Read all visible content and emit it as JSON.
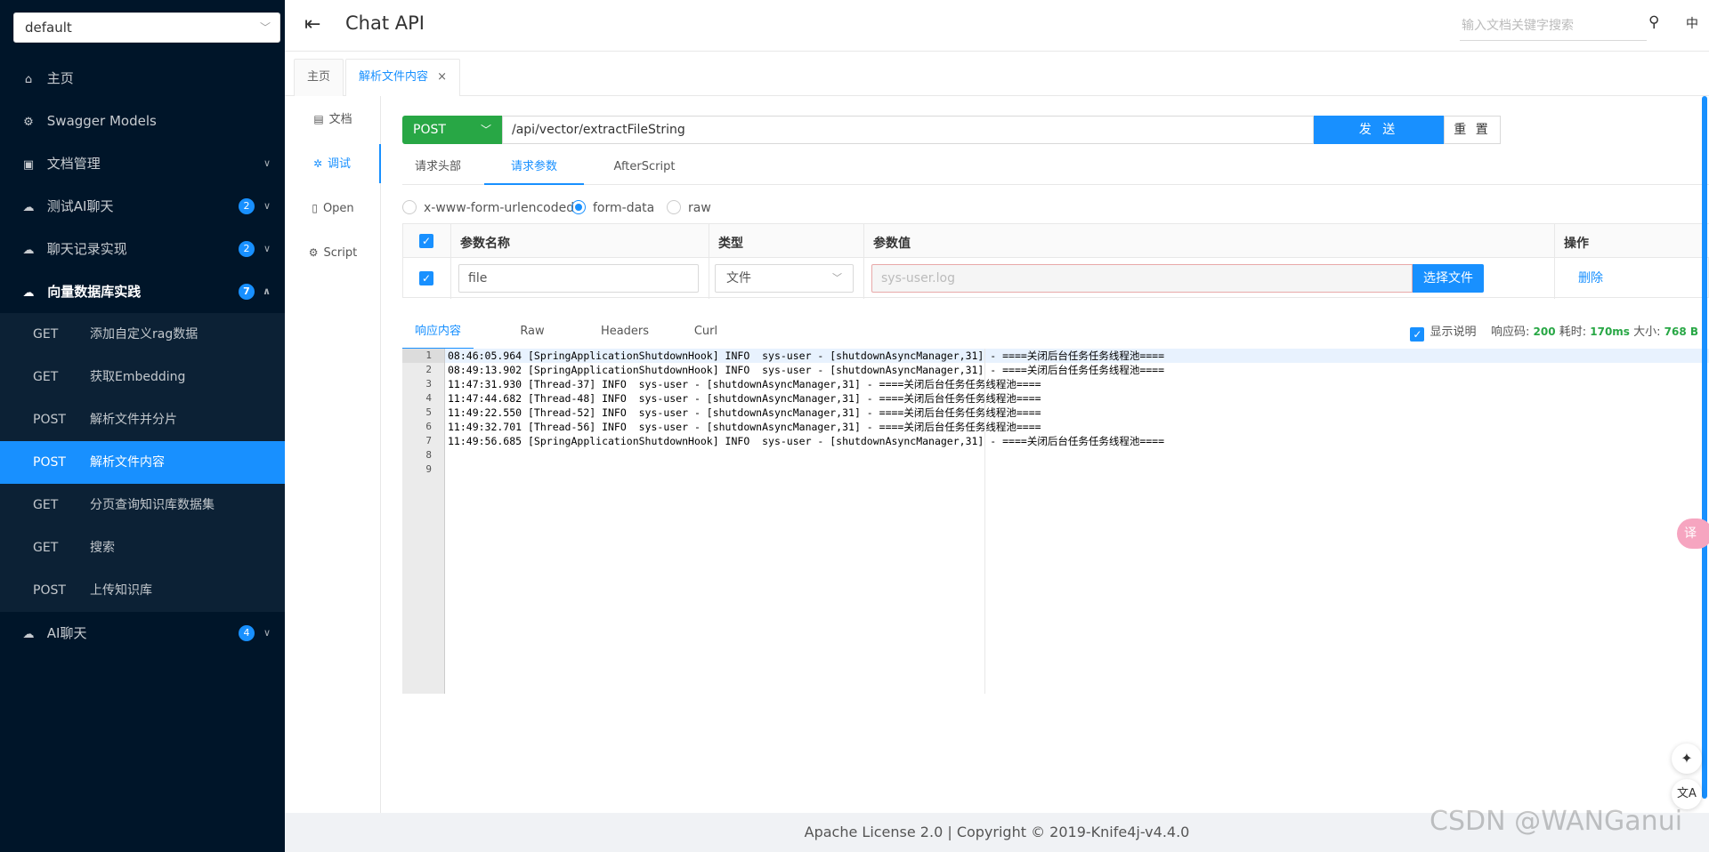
{
  "sidebar": {
    "group_select": "default",
    "menu": [
      {
        "label": "主页",
        "icon": "home-icon",
        "glyph": "⌂"
      },
      {
        "label": "Swagger Models",
        "icon": "gear-icon",
        "glyph": "⚙"
      },
      {
        "label": "文档管理",
        "icon": "document-icon",
        "glyph": "▣"
      },
      {
        "label": "测试AI聊天",
        "icon": "cloud-icon",
        "glyph": "☁",
        "badge": "2"
      },
      {
        "label": "聊天记录实现",
        "icon": "cloud-icon",
        "glyph": "☁",
        "badge": "2"
      },
      {
        "label": "向量数据库实践",
        "icon": "cloud-icon",
        "glyph": "☁",
        "badge": "7"
      },
      {
        "label": "AI聊天",
        "icon": "cloud-icon",
        "glyph": "☁",
        "badge": "4"
      }
    ],
    "sub_items": [
      {
        "method": "GET",
        "label": "添加自定义rag数据"
      },
      {
        "method": "GET",
        "label": "获取Embedding"
      },
      {
        "method": "POST",
        "label": "解析文件并分片"
      },
      {
        "method": "POST",
        "label": "解析文件内容"
      },
      {
        "method": "GET",
        "label": "分页查询知识库数据集"
      },
      {
        "method": "GET",
        "label": "搜索"
      },
      {
        "method": "POST",
        "label": "上传知识库"
      }
    ]
  },
  "header": {
    "title": "Chat API",
    "search_placeholder": "输入文档关键字搜索",
    "lang": "中"
  },
  "tabs": [
    {
      "label": "主页"
    },
    {
      "label": "解析文件内容",
      "close": "×"
    }
  ],
  "left_nav": [
    {
      "label": "文档",
      "glyph": "▤"
    },
    {
      "label": "调试",
      "glyph": "✲"
    },
    {
      "label": "Open",
      "glyph": "▯"
    },
    {
      "label": "Script",
      "glyph": "⚙"
    }
  ],
  "request": {
    "method": "POST",
    "url": "/api/vector/extractFileString",
    "send_label": "发 送",
    "reset_label": "重 置",
    "tabs": [
      "请求头部",
      "请求参数",
      "AfterScript"
    ],
    "body_types": [
      "x-www-form-urlencoded",
      "form-data",
      "raw"
    ],
    "selected_body_type": "form-data"
  },
  "param_table": {
    "headers": {
      "name": "参数名称",
      "type": "类型",
      "value": "参数值",
      "action": "操作"
    },
    "row": {
      "name": "file",
      "type": "文件",
      "value_placeholder": "sys-user.log",
      "choose_label": "选择文件",
      "delete_label": "删除"
    }
  },
  "response": {
    "tabs": [
      "响应内容",
      "Raw",
      "Headers",
      "Curl"
    ],
    "show_desc": "显示说明",
    "code_label": "响应码:",
    "code": "200",
    "time_label": "耗时:",
    "time": "170ms",
    "size_label": "大小:",
    "size": "768 B",
    "line_numbers": [
      "1",
      "2",
      "3",
      "4",
      "5",
      "6",
      "7",
      "8",
      "9"
    ],
    "lines": [
      "08:46:05.964 [SpringApplicationShutdownHook] INFO  sys-user - [shutdownAsyncManager,31] - ====关闭后台任务任务线程池====",
      "08:49:13.902 [SpringApplicationShutdownHook] INFO  sys-user - [shutdownAsyncManager,31] - ====关闭后台任务任务线程池====",
      "11:47:31.930 [Thread-37] INFO  sys-user - [shutdownAsyncManager,31] - ====关闭后台任务任务线程池====",
      "11:47:44.682 [Thread-48] INFO  sys-user - [shutdownAsyncManager,31] - ====关闭后台任务任务线程池====",
      "11:49:22.550 [Thread-52] INFO  sys-user - [shutdownAsyncManager,31] - ====关闭后台任务任务线程池====",
      "11:49:32.701 [Thread-56] INFO  sys-user - [shutdownAsyncManager,31] - ====关闭后台任务任务线程池====",
      "11:49:56.685 [SpringApplicationShutdownHook] INFO  sys-user - [shutdownAsyncManager,31] - ====关闭后台任务任务线程池====",
      "",
      ""
    ]
  },
  "footer": "Apache License 2.0 | Copyright © 2019-Knife4j-v4.4.0",
  "watermark": "CSDN @WANGanui",
  "floating": {
    "sparkle": "✦",
    "translate": "文A",
    "bubble": "译"
  },
  "colors": {
    "sidebar_bg": "#001529",
    "accent": "#1890ff",
    "method_post": "#28a745"
  }
}
